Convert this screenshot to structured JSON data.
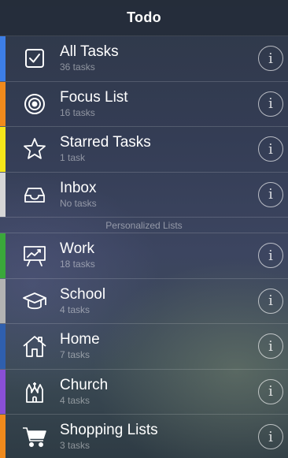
{
  "header": {
    "title": "Todo"
  },
  "main_lists": [
    {
      "name": "all-tasks",
      "label": "All Tasks",
      "count": "36 tasks",
      "color": "#3d7ee6",
      "icon": "checkbox-icon"
    },
    {
      "name": "focus-list",
      "label": "Focus List",
      "count": "16 tasks",
      "color": "#f08a1c",
      "icon": "target-icon"
    },
    {
      "name": "starred-tasks",
      "label": "Starred Tasks",
      "count": "1 task",
      "color": "#f5e61a",
      "icon": "star-icon"
    },
    {
      "name": "inbox",
      "label": "Inbox",
      "count": "No tasks",
      "color": "#d6d6d6",
      "icon": "inbox-icon"
    }
  ],
  "section": {
    "label": "Personalized Lists"
  },
  "personal_lists": [
    {
      "name": "work",
      "label": "Work",
      "count": "18 tasks",
      "color": "#3aa83a",
      "icon": "presentation-icon"
    },
    {
      "name": "school",
      "label": "School",
      "count": "4 tasks",
      "color": "#b3b3b3",
      "icon": "graduation-cap-icon"
    },
    {
      "name": "home",
      "label": "Home",
      "count": "7 tasks",
      "color": "#2f5fae",
      "icon": "house-icon"
    },
    {
      "name": "church",
      "label": "Church",
      "count": "4 tasks",
      "color": "#8a4fd6",
      "icon": "church-icon"
    },
    {
      "name": "shopping-lists",
      "label": "Shopping Lists",
      "count": "3 tasks",
      "color": "#f08a1c",
      "icon": "shopping-cart-icon"
    }
  ],
  "info_glyph": "i"
}
